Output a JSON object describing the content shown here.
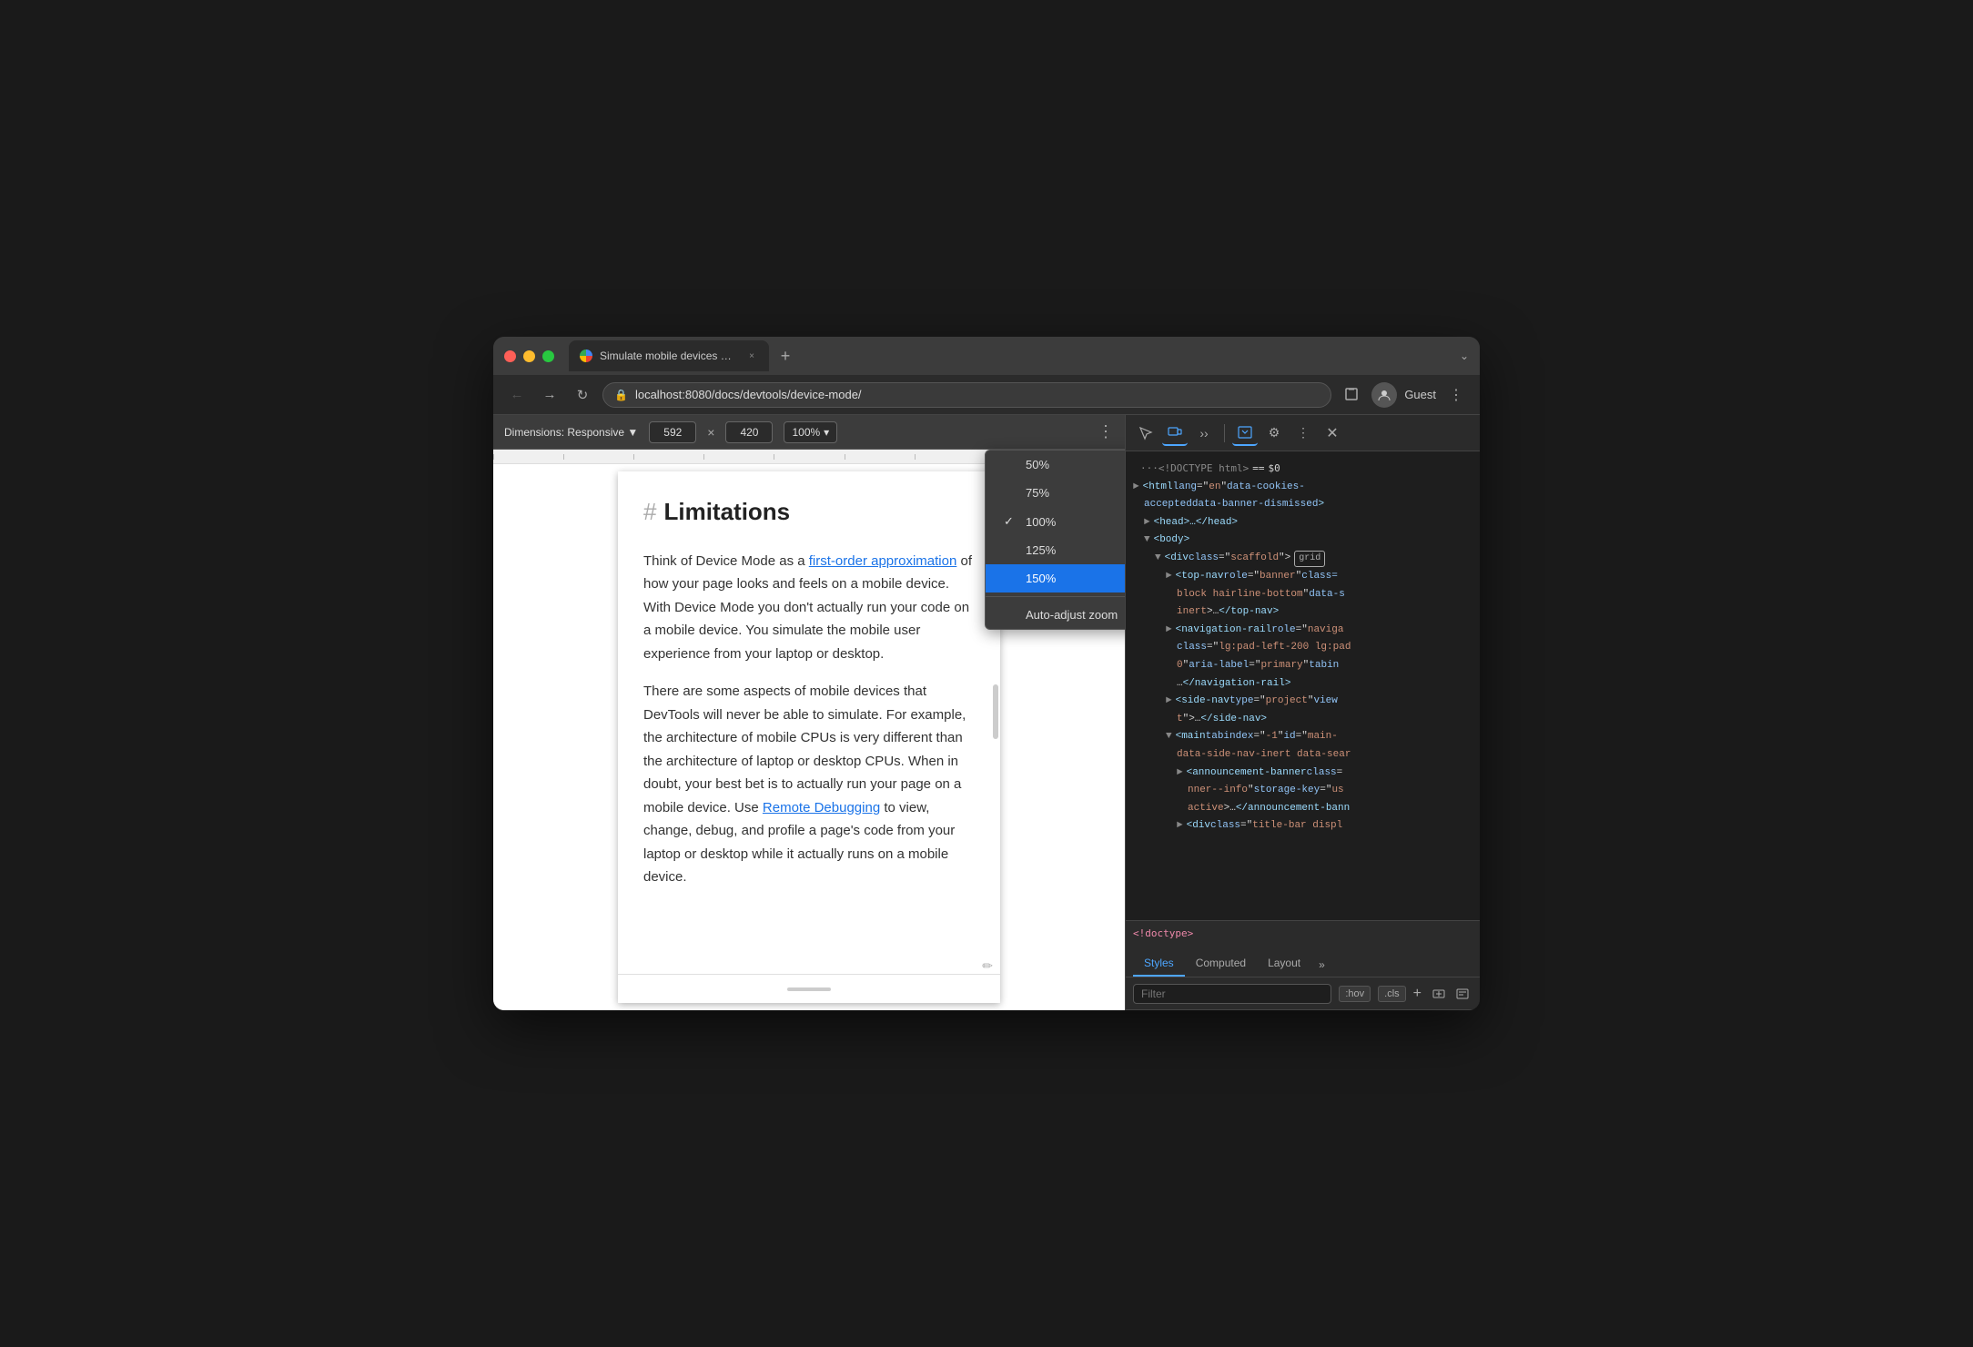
{
  "browser": {
    "title": "Simulate mobile devices with D",
    "url": "localhost:8080/docs/devtools/device-mode/",
    "tab_close": "×",
    "new_tab": "+",
    "profile": "Guest",
    "chevron": "›"
  },
  "toolbar": {
    "dimensions_label": "Dimensions: Responsive ▼",
    "width": "592",
    "height": "420",
    "sep": "×",
    "zoom": "100%",
    "zoom_arrow": "▾"
  },
  "zoom_menu": {
    "items": [
      {
        "label": "50%",
        "checked": false,
        "selected": false
      },
      {
        "label": "75%",
        "checked": false,
        "selected": false
      },
      {
        "label": "100%",
        "checked": true,
        "selected": false
      },
      {
        "label": "125%",
        "checked": false,
        "selected": false
      },
      {
        "label": "150%",
        "checked": false,
        "selected": true
      },
      {
        "label": "Auto-adjust zoom",
        "checked": false,
        "selected": false
      }
    ]
  },
  "page": {
    "heading_hash": "#",
    "heading": "Limitations",
    "para1_part1": "Think of Device Mode as a ",
    "para1_link": "first-order approximation",
    "para1_part2": " of how your page looks and feels on a mobile device. With Device Mode you don't actually run your code on a mobile device. You simulate the mobile user experience from your laptop or desktop.",
    "para2_part1": "There are some aspects of mobile devices that DevTools will never be able to simulate. For example, the architecture of mobile CPUs is very different than the architecture of laptop or desktop CPUs. When in doubt, your best bet is to actually run your page on a mobile device. Use ",
    "para2_link": "Remote Debugging",
    "para2_part2": " to view, change, debug, and profile a page's code from your laptop or desktop while it actually runs on a mobile device."
  },
  "devtools": {
    "tabs_bottom": [
      "Styles",
      "Computed",
      "Layout"
    ],
    "tabs_more": "»",
    "filter_placeholder": "Filter",
    "filter_hov": ":hov",
    "filter_cls": ".cls",
    "html": {
      "line1_comment": "···<!DOCTYPE html> == $0",
      "line2": "<html lang=\"en\" data-cookies-",
      "line3": "accepted data-banner-dismissed>",
      "line4_expand": "▶",
      "line4": "<head>…</head>",
      "line5_expand": "▼",
      "line5": "<body>",
      "line6_expand": "▼",
      "line6": "<div class=\"scaffold\">",
      "line6_badge": "grid",
      "line7_expand": "▶",
      "line7": "<top-nav role=\"banner\" class=",
      "line8": "block hairline-bottom\" data-s",
      "line9": "inert>…</top-nav>",
      "line10_expand": "▶",
      "line10": "<navigation-rail role=\"naviga",
      "line11": "class=\"lg:pad-left-200 lg:pad",
      "line12": "0\" aria-label=\"primary\" tabin",
      "line13": "…</navigation-rail>",
      "line14_expand": "▶",
      "line14": "<side-nav type=\"project\" view",
      "line15": "t\">…</side-nav>",
      "line16_expand": "▼",
      "line16": "<main tabindex=\"-1\" id=\"main-",
      "line17": "data-side-nav-inert data-sear",
      "line18_expand": "▶",
      "line18": "<announcement-banner class=",
      "line19": "nner--info\" storage-key=\"us",
      "line20": "active>…</announcement-bann",
      "line21_expand": "▶",
      "line21": "<div class=\"title-bar displ",
      "line22": "<!doctype>",
      "styles_tab": "Styles",
      "computed_tab": "Computed",
      "layout_tab": "Layout"
    }
  }
}
